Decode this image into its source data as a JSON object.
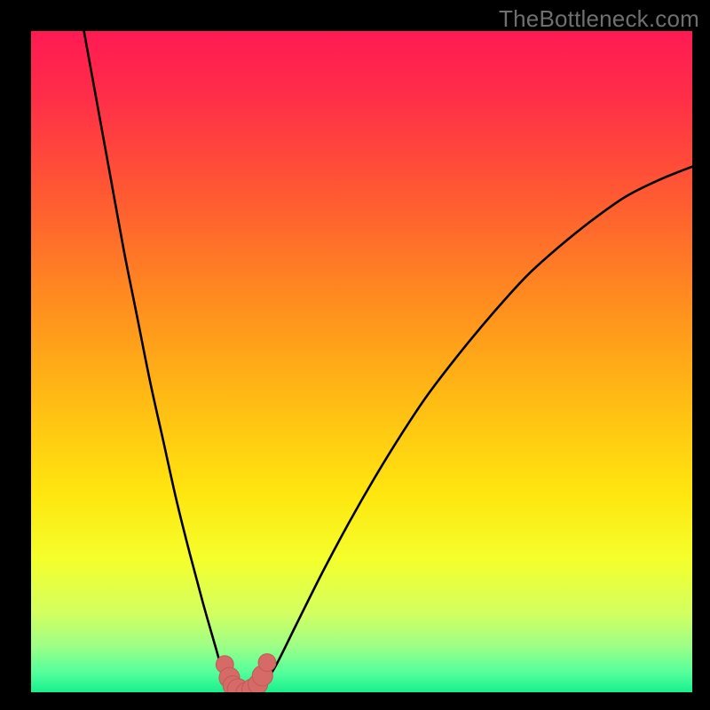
{
  "watermark": "TheBottleneck.com",
  "colors": {
    "frame": "#000000",
    "gradient_stops": [
      {
        "offset": 0.0,
        "color": "#ff1a53"
      },
      {
        "offset": 0.1,
        "color": "#ff2e48"
      },
      {
        "offset": 0.25,
        "color": "#ff5a32"
      },
      {
        "offset": 0.4,
        "color": "#ff8a20"
      },
      {
        "offset": 0.55,
        "color": "#ffb914"
      },
      {
        "offset": 0.7,
        "color": "#ffe60f"
      },
      {
        "offset": 0.8,
        "color": "#f4ff2c"
      },
      {
        "offset": 0.88,
        "color": "#d3ff60"
      },
      {
        "offset": 0.93,
        "color": "#9dff86"
      },
      {
        "offset": 0.97,
        "color": "#54ff9c"
      },
      {
        "offset": 1.0,
        "color": "#17f08e"
      }
    ],
    "curve": "#000000",
    "knot": "#d66a66",
    "knot_outline": "#c05a57"
  },
  "chart_data": {
    "type": "line",
    "title": "",
    "xlabel": "",
    "ylabel": "",
    "xlim": [
      0,
      100
    ],
    "ylim": [
      0,
      100
    ],
    "grid": false,
    "legend": false,
    "note": "Values are read off the pixel positions; y is 0 at the curve's trough (green band) and ~100 at top of plot area.",
    "series": [
      {
        "name": "left-branch",
        "x": [
          8.0,
          10.0,
          12.0,
          14.0,
          16.0,
          18.0,
          20.0,
          22.0,
          24.0,
          26.0,
          28.0,
          29.0,
          30.0
        ],
        "y": [
          100.0,
          89.0,
          78.0,
          67.0,
          57.0,
          47.0,
          38.0,
          29.0,
          21.0,
          13.5,
          6.5,
          3.0,
          1.0
        ]
      },
      {
        "name": "trough",
        "x": [
          30.0,
          31.0,
          32.0,
          33.0,
          34.0,
          35.0
        ],
        "y": [
          1.0,
          0.3,
          0.0,
          0.0,
          0.3,
          1.0
        ]
      },
      {
        "name": "right-branch",
        "x": [
          35.0,
          37.0,
          40.0,
          44.0,
          48.0,
          52.0,
          56.0,
          60.0,
          65.0,
          70.0,
          75.0,
          80.0,
          85.0,
          90.0,
          95.0,
          100.0
        ],
        "y": [
          1.0,
          4.0,
          10.0,
          18.0,
          25.5,
          32.5,
          39.0,
          45.0,
          51.5,
          57.5,
          63.0,
          67.5,
          71.5,
          75.0,
          77.5,
          79.5
        ]
      }
    ],
    "markers": {
      "name": "trough-knot",
      "x": [
        29.3,
        30.0,
        30.5,
        31.3,
        32.5,
        33.5,
        34.3,
        35.0,
        35.7
      ],
      "y": [
        4.2,
        2.2,
        1.0,
        0.4,
        0.0,
        0.4,
        1.2,
        2.5,
        4.5
      ],
      "radius_scale": [
        0.9,
        1.05,
        1.0,
        1.1,
        1.0,
        1.1,
        1.0,
        1.05,
        0.9
      ]
    }
  }
}
